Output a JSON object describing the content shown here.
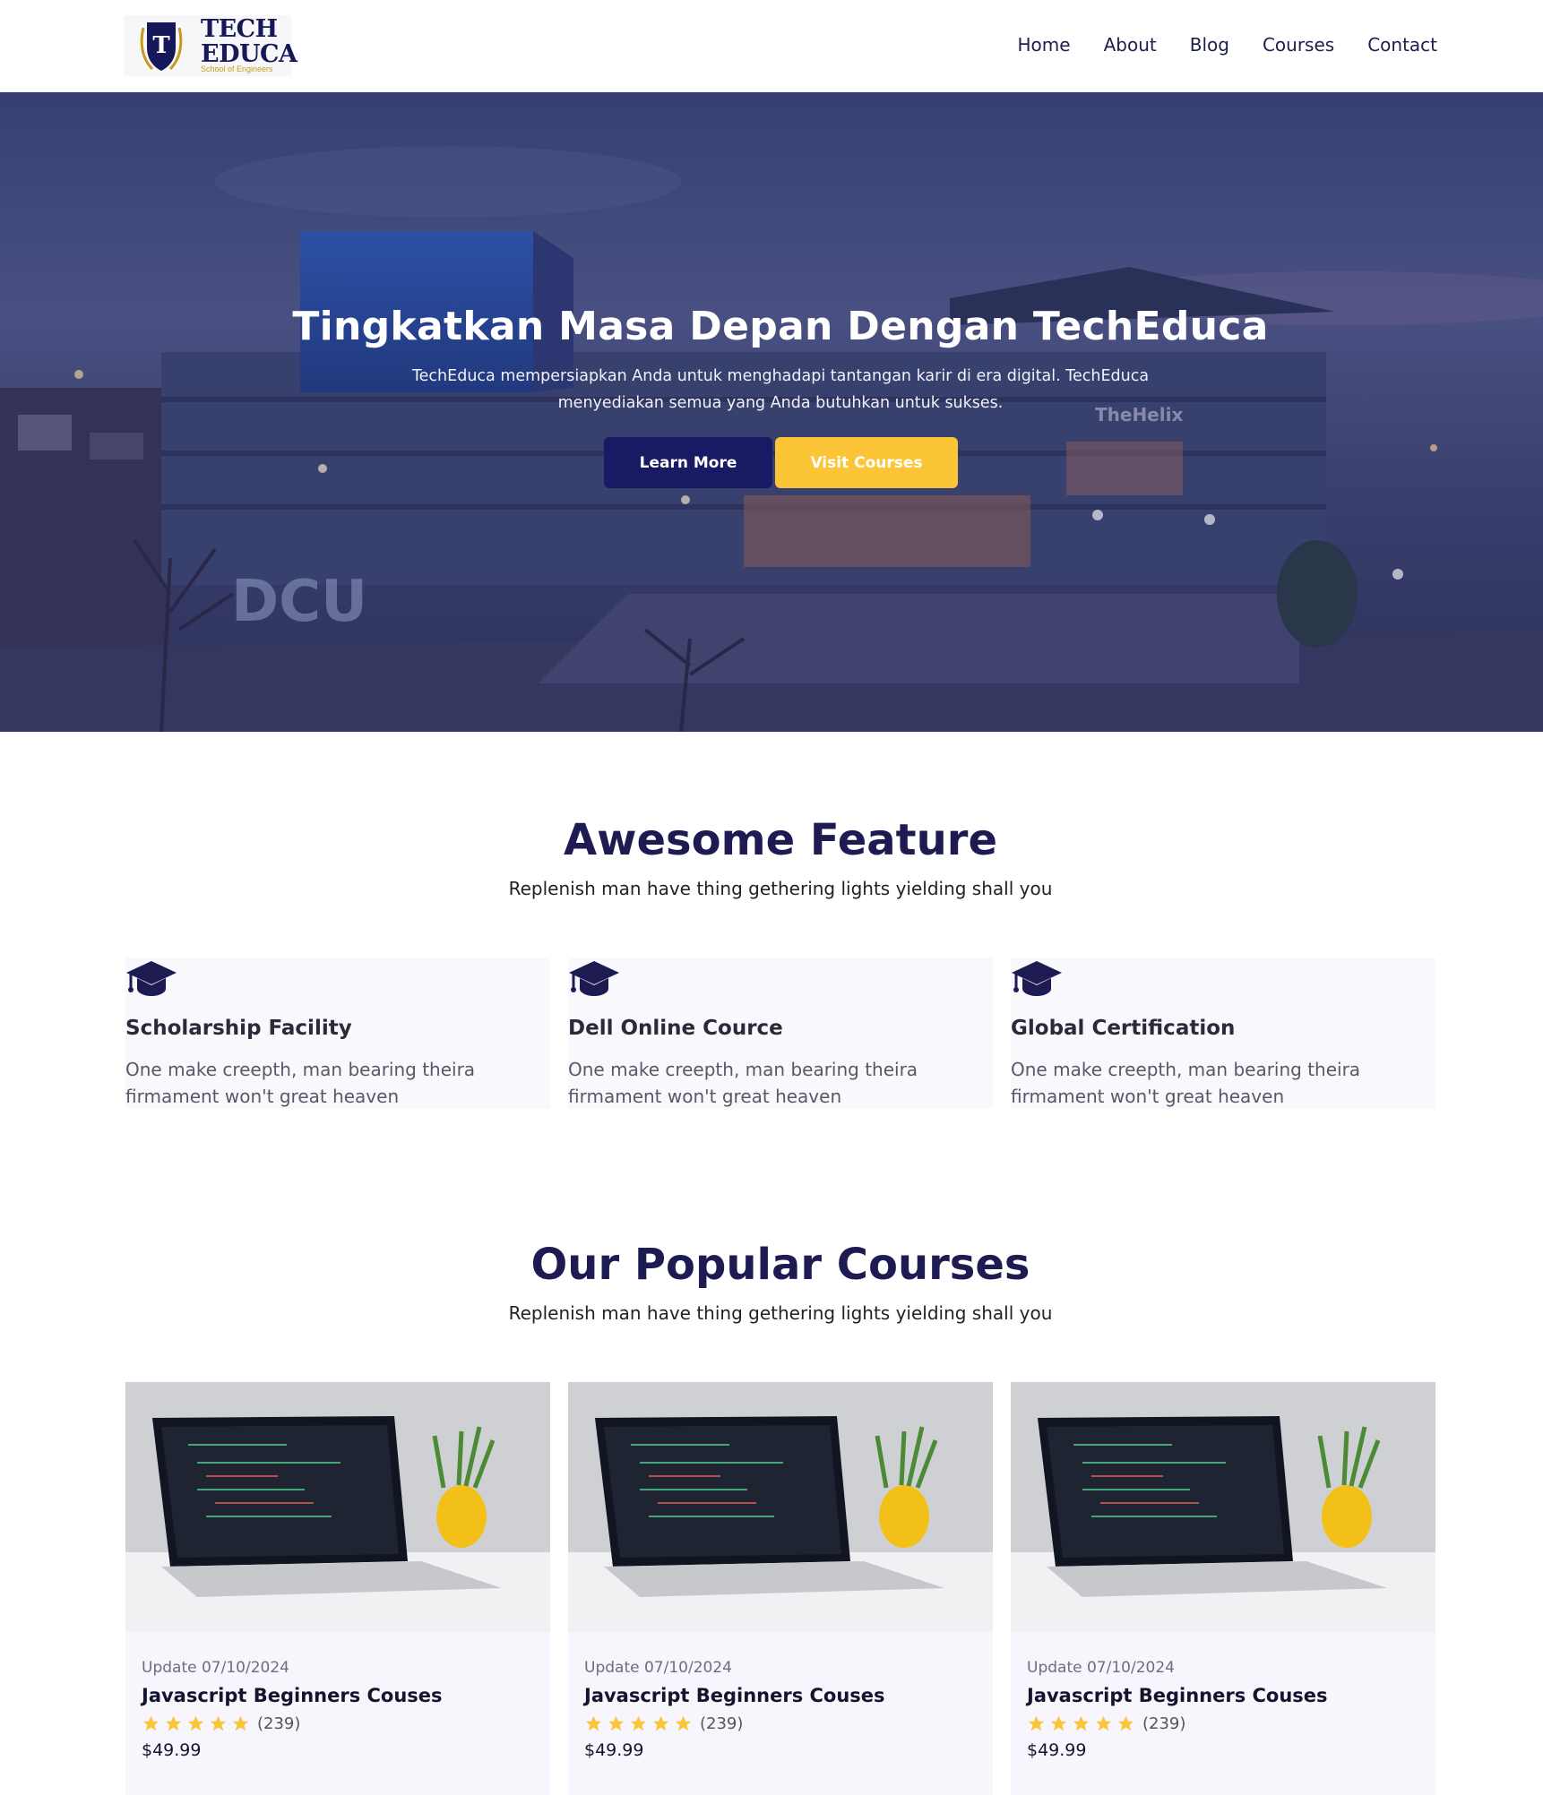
{
  "header": {
    "logo": {
      "line1": "TECH",
      "line2": "EDUCA",
      "tagline": "School of Engineers",
      "shield_letter": "T"
    },
    "nav": [
      "Home",
      "About",
      "Blog",
      "Courses",
      "Contact"
    ]
  },
  "hero": {
    "title": "Tingkatkan Masa Depan Dengan TechEduca",
    "subtitle": "TechEduca mempersiapkan Anda untuk menghadapi tantangan karir di era digital. TechEduca menyediakan semua yang Anda butuhkan untuk sukses.",
    "primary_button": "Learn More",
    "secondary_button": "Visit Courses",
    "building_sign": "TheHelix",
    "campus_sign": "DCU"
  },
  "features": {
    "title": "Awesome Feature",
    "subtitle": "Replenish man have thing gethering lights yielding shall you",
    "items": [
      {
        "icon": "graduation-cap-icon",
        "title": "Scholarship Facility",
        "text": "One make creepth, man bearing theira firmament won't great heaven"
      },
      {
        "icon": "graduation-cap-icon",
        "title": "Dell Online Cource",
        "text": "One make creepth, man bearing theira firmament won't great heaven"
      },
      {
        "icon": "graduation-cap-icon",
        "title": "Global Certification",
        "text": "One make creepth, man bearing theira firmament won't great heaven"
      }
    ]
  },
  "courses": {
    "title": "Our Popular Courses",
    "subtitle": "Replenish man have thing gethering lights yielding shall you",
    "items": [
      {
        "date": "Update 07/10/2024",
        "title": "Javascript Beginners Couses",
        "stars": 5,
        "rating_count": "(239)",
        "price": "$49.99"
      },
      {
        "date": "Update 07/10/2024",
        "title": "Javascript Beginners Couses",
        "stars": 5,
        "rating_count": "(239)",
        "price": "$49.99"
      },
      {
        "date": "Update 07/10/2024",
        "title": "Javascript Beginners Couses",
        "stars": 5,
        "rating_count": "(239)",
        "price": "$49.99"
      }
    ]
  },
  "colors": {
    "navy": "#181a63",
    "accent_yellow": "#fbc537",
    "heading": "#1e1b52",
    "star": "#fbc537"
  }
}
